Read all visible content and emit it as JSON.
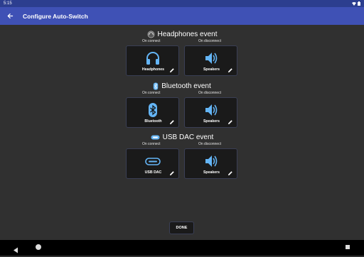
{
  "statusbar": {
    "time": "5:15"
  },
  "appbar": {
    "title": "Configure Auto-Switch"
  },
  "sections": [
    {
      "title": "Headphones event",
      "on_connect": "On connect",
      "on_disconnect": "On disconnect",
      "connect_card": "Headphones",
      "disconnect_card": "Speakers"
    },
    {
      "title": "Bluetooth event",
      "on_connect": "On connect",
      "on_disconnect": "On disconnect",
      "connect_card": "Bluetooth",
      "disconnect_card": "Speakers"
    },
    {
      "title": "USB DAC event",
      "on_connect": "On connect",
      "on_disconnect": "On disconnect",
      "connect_card": "USB DAC",
      "disconnect_card": "Speakers"
    }
  ],
  "done_label": "DONE",
  "colors": {
    "appbar": "#3f51b5",
    "statusbar": "#2c3e8f",
    "background": "#303030",
    "icon_blue": "#64b5f6"
  }
}
